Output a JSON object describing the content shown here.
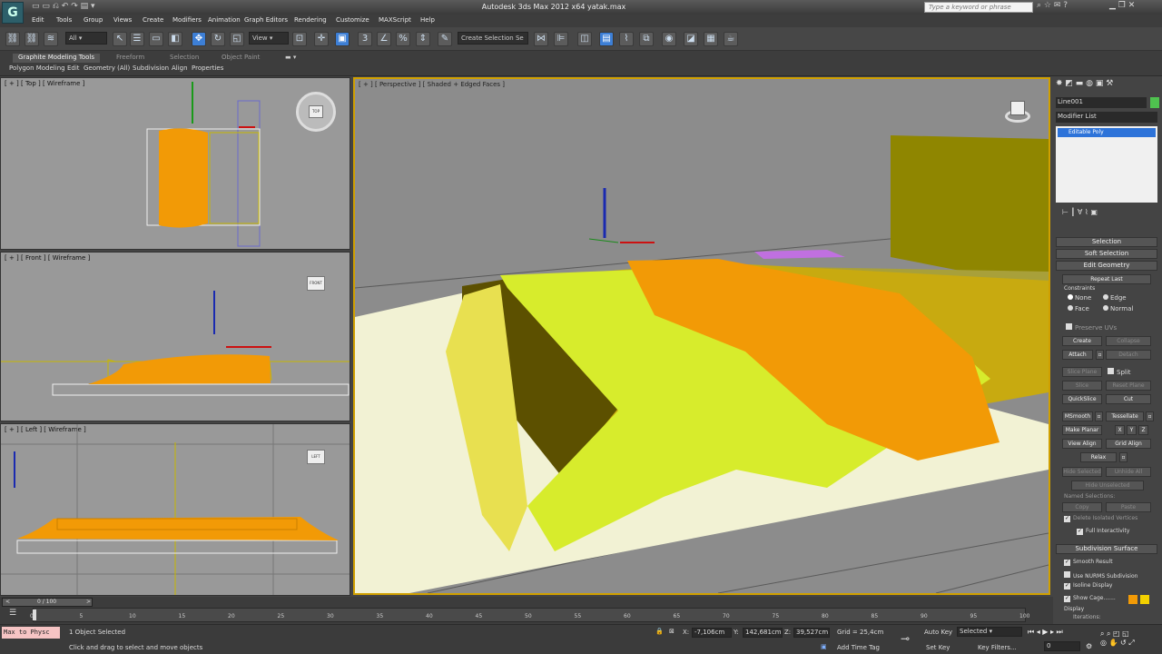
{
  "app": {
    "title": "Autodesk 3ds Max 2012 x64     yatak.max",
    "search_placeholder": "Type a keyword or phrase",
    "logo_glyph": "G"
  },
  "menu": [
    "Edit",
    "Tools",
    "Group",
    "Views",
    "Create",
    "Modifiers",
    "Animation",
    "Graph Editors",
    "Rendering",
    "Customize",
    "MAXScript",
    "Help"
  ],
  "toolbar": {
    "selection_filter": "All",
    "reference_coord": "View",
    "named_selection": "Create Selection Se"
  },
  "ribbon": {
    "tabs": [
      "Graphite Modeling Tools",
      "Freeform",
      "Selection",
      "Object Paint"
    ],
    "subtabs": [
      "Polygon Modeling",
      "Edit",
      "Geometry (All)",
      "Subdivision",
      "Align",
      "Properties"
    ]
  },
  "viewports": {
    "top": "[ + ] [ Top ] [ Wireframe ]",
    "front": "[ + ] [ Front ] [ Wireframe ]",
    "left": "[ + ] [ Left ] [ Wireframe ]",
    "perspective": "[ + ] [ Perspective ] [ Shaded + Edged Faces ]",
    "cube_top": "TOP",
    "cube_front": "FRONT",
    "cube_left": "LEFT"
  },
  "command_panel": {
    "object_name": "Line001",
    "modifier_list": "Modifier List",
    "stack_item": "Editable Poly",
    "rollouts": {
      "selection": "Selection",
      "soft_selection": "Soft Selection",
      "edit_geometry": "Edit Geometry",
      "subdivision_surface": "Subdivision Surface"
    },
    "repeat_last": "Repeat Last",
    "constraints_label": "Constraints",
    "constraints": {
      "none": "None",
      "edge": "Edge",
      "face": "Face",
      "normal": "Normal"
    },
    "preserve_uvs": "Preserve UVs",
    "create": "Create",
    "collapse": "Collapse",
    "attach": "Attach",
    "detach": "Detach",
    "slice_plane": "Slice Plane",
    "split": "Split",
    "slice": "Slice",
    "reset_plane": "Reset Plane",
    "quickslice": "QuickSlice",
    "cut": "Cut",
    "msmooth": "MSmooth",
    "tessellate": "Tessellate",
    "make_planar": "Make Planar",
    "x": "X",
    "y": "Y",
    "z": "Z",
    "view_align": "View Align",
    "grid_align": "Grid Align",
    "relax": "Relax",
    "hide_selected": "Hide Selected",
    "unhide_all": "Unhide All",
    "hide_unselected": "Hide Unselected",
    "named_selections": "Named Selections:",
    "copy": "Copy",
    "paste": "Paste",
    "delete_isolated": "Delete Isolated Vertices",
    "full_interactivity": "Full Interactivity",
    "smooth_result": "Smooth Result",
    "use_nurms": "Use NURMS Subdivision",
    "isoline_display": "Isoline Display",
    "show_cage": "Show Cage.......",
    "display": "Display",
    "iterations": "Iterations:"
  },
  "timeline": {
    "frame": "0 / 100",
    "ticks": [
      "0",
      "5",
      "10",
      "15",
      "20",
      "25",
      "30",
      "35",
      "40",
      "45",
      "50",
      "55",
      "60",
      "65",
      "70",
      "75",
      "80",
      "85",
      "90",
      "95",
      "100"
    ]
  },
  "status": {
    "maxscript": "Max to Physc",
    "selected": "1 Object Selected",
    "prompt": "Click and drag to select and move objects",
    "x_label": "X:",
    "x": "-7,106cm",
    "y_label": "Y:",
    "y": "142,681cm",
    "z_label": "Z:",
    "z": "39,527cm",
    "grid": "Grid = 25,4cm",
    "add_time_tag": "Add Time Tag",
    "auto_key": "Auto Key",
    "auto_key_mode": "Selected",
    "set_key": "Set Key",
    "key_filters": "Key Filters...",
    "current_frame": "0"
  },
  "colors": {
    "orange": "#f29a06",
    "olive": "#b8a31d",
    "selection_blue": "#3d7fd6"
  }
}
